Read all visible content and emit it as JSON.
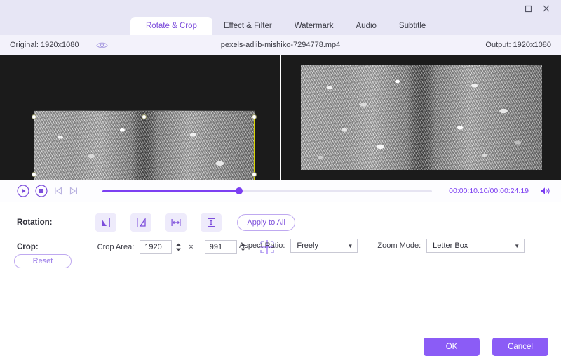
{
  "window": {
    "maximize_label": "maximize-window",
    "close_label": "close-window"
  },
  "tabs": [
    {
      "label": "Rotate & Crop",
      "active": true
    },
    {
      "label": "Effect & Filter",
      "active": false
    },
    {
      "label": "Watermark",
      "active": false
    },
    {
      "label": "Audio",
      "active": false
    },
    {
      "label": "Subtitle",
      "active": false
    }
  ],
  "infobar": {
    "original": "Original: 1920x1080",
    "filename": "pexels-adlib-mishiko-7294778.mp4",
    "output": "Output: 1920x1080",
    "eye_icon": "eye-icon"
  },
  "player": {
    "play_icon": "play-icon",
    "stop_icon": "stop-icon",
    "prev_frame_icon": "previous-frame-icon",
    "next_frame_icon": "next-frame-icon",
    "volume_icon": "volume-icon",
    "current_time": "00:00:10.10",
    "total_time": "00:00:24.19",
    "time_display": "00:00:10.10/00:00:24.19",
    "progress_percent": 41.5
  },
  "rotation": {
    "label": "Rotation:",
    "buttons": [
      {
        "name": "rotate-left-icon"
      },
      {
        "name": "rotate-right-icon"
      },
      {
        "name": "flip-horizontal-icon"
      },
      {
        "name": "flip-vertical-icon"
      }
    ],
    "apply_to_all": "Apply to All"
  },
  "crop": {
    "label": "Crop:",
    "area_label": "Crop Area:",
    "width": "1920",
    "times": "×",
    "height": "991",
    "position_icon": "crop-position-icon",
    "reset": "Reset",
    "aspect_ratio_label": "Aspect Ratio:",
    "aspect_ratio_value": "Freely",
    "zoom_mode_label": "Zoom Mode:",
    "zoom_mode_value": "Letter Box"
  },
  "footer": {
    "ok": "OK",
    "cancel": "Cancel"
  },
  "colors": {
    "accent": "#7c3ff2",
    "button": "#8b5cf6",
    "header_bg": "#e7e6f5",
    "crop_border": "#d8d400"
  }
}
